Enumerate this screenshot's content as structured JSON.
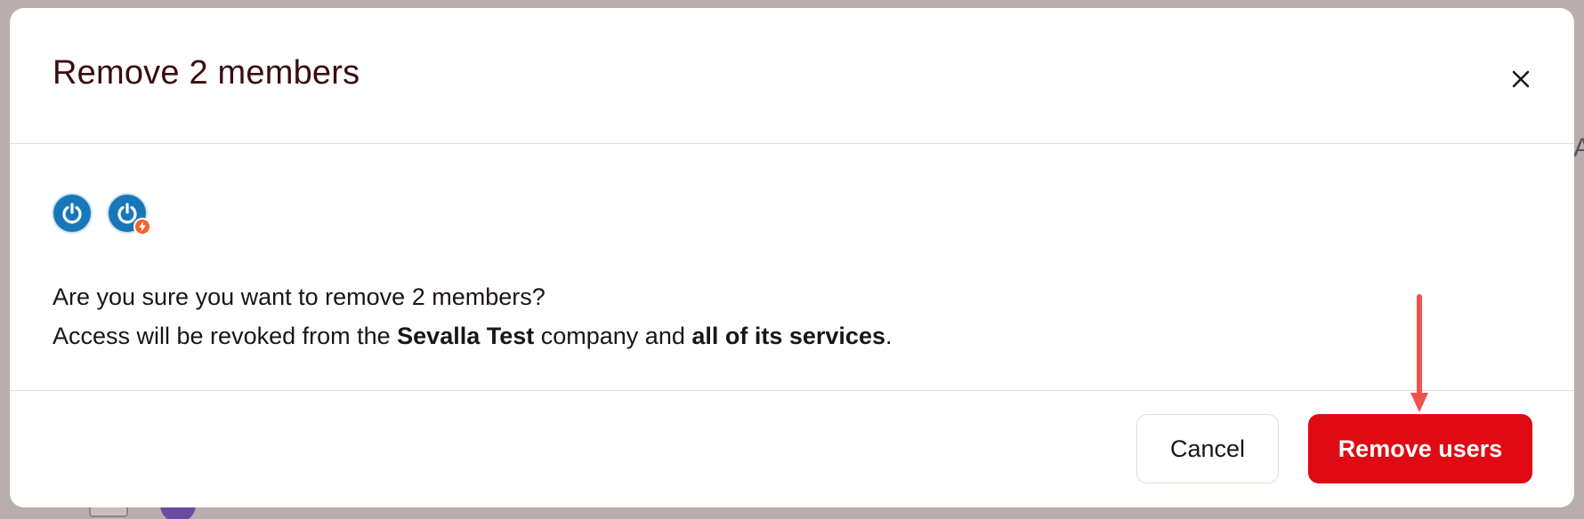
{
  "dialog": {
    "title": "Remove 2 members",
    "avatars": [
      {
        "icon": "power-icon",
        "badge": null
      },
      {
        "icon": "power-icon",
        "badge": "lightning-icon"
      }
    ],
    "message": {
      "line1": "Are you sure you want to remove 2 members?",
      "line2_prefix": "Access will be revoked from the ",
      "company": "Sevalla Test",
      "line2_middle": " company and ",
      "scope": "all of its services",
      "line2_suffix": "."
    },
    "buttons": {
      "cancel": "Cancel",
      "remove": "Remove users"
    }
  },
  "colors": {
    "title": "#3a0d12",
    "danger": "#df0a13",
    "avatar": "#1877b8",
    "badge": "#f2622a",
    "divider": "#ecd9cf",
    "annotation_arrow": "#f0524c"
  },
  "background": {
    "edge_text": "A"
  }
}
